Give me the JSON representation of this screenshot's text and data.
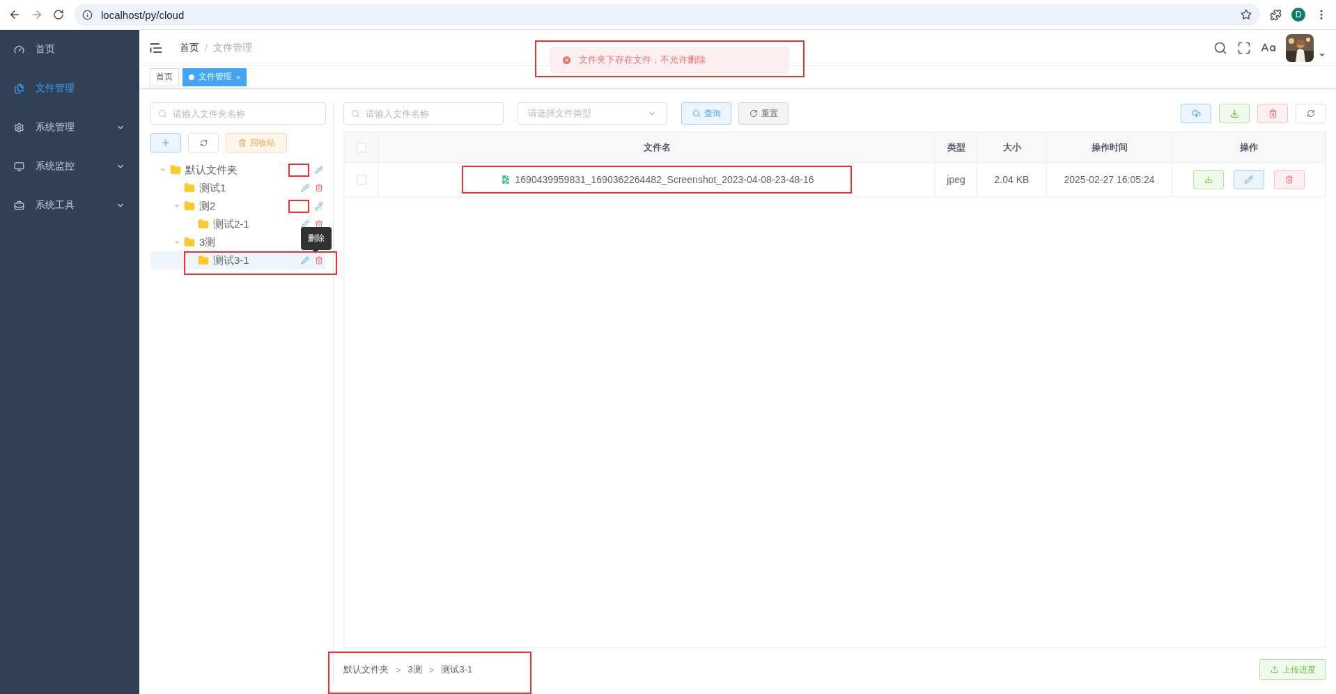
{
  "browser": {
    "url": "localhost/py/cloud",
    "profile": "D"
  },
  "sidebar": {
    "items": [
      {
        "label": "首页",
        "selected": false,
        "expandable": false
      },
      {
        "label": "文件管理",
        "selected": true,
        "expandable": false
      },
      {
        "label": "系统管理",
        "selected": false,
        "expandable": true
      },
      {
        "label": "系统监控",
        "selected": false,
        "expandable": true
      },
      {
        "label": "系统工具",
        "selected": false,
        "expandable": true
      }
    ]
  },
  "header": {
    "breadcrumb": [
      "首页",
      "文件管理"
    ],
    "separator": "/"
  },
  "tabs": [
    {
      "label": "首页",
      "selected": false
    },
    {
      "label": "文件管理",
      "selected": true,
      "close": "×"
    }
  ],
  "message": {
    "text": "文件夹下存在文件，不允许删除",
    "highlighted": true
  },
  "folder_panel": {
    "search": {
      "placeholder": "请输入文件夹名称"
    },
    "recycle_button": "回收站",
    "tree": [
      {
        "label": "默认文件夹",
        "expanded": true,
        "selected": false,
        "delete_covered": true,
        "children": [
          {
            "label": "测试1",
            "selected": false
          },
          {
            "label": "测2",
            "expanded": true,
            "selected": false,
            "delete_covered": true,
            "children": [
              {
                "label": "测试2-1",
                "selected": false
              }
            ]
          },
          {
            "label": "3测",
            "expanded": true,
            "selected": false,
            "children": [
              {
                "label": "测试3-1",
                "selected": true,
                "highlighted": true,
                "tooltip": "删除"
              }
            ]
          }
        ]
      }
    ]
  },
  "file_panel": {
    "search": {
      "placeholder": "请输入文件名称"
    },
    "type_select": {
      "placeholder": "请选择文件类型"
    },
    "query_button": "查询",
    "reset_button": "重置",
    "table": {
      "select_all": false,
      "columns": [
        "文件名",
        "类型",
        "大小",
        "操作时间",
        "操作"
      ],
      "rows": [
        {
          "checked": false,
          "name": "1690439959831_1690362264482_Screenshot_2023-04-08-23-48-16",
          "type": "jpeg",
          "size": "2.04 KB",
          "time": "2025-02-27 16:05:24",
          "highlighted": true
        }
      ]
    },
    "path": [
      {
        "label": "默认文件夹",
        "separator": ">"
      },
      {
        "label": "3测",
        "separator": ">"
      },
      {
        "label": "测试3-1"
      }
    ],
    "path_highlighted": true,
    "upload_progress_button": "上传进度"
  }
}
